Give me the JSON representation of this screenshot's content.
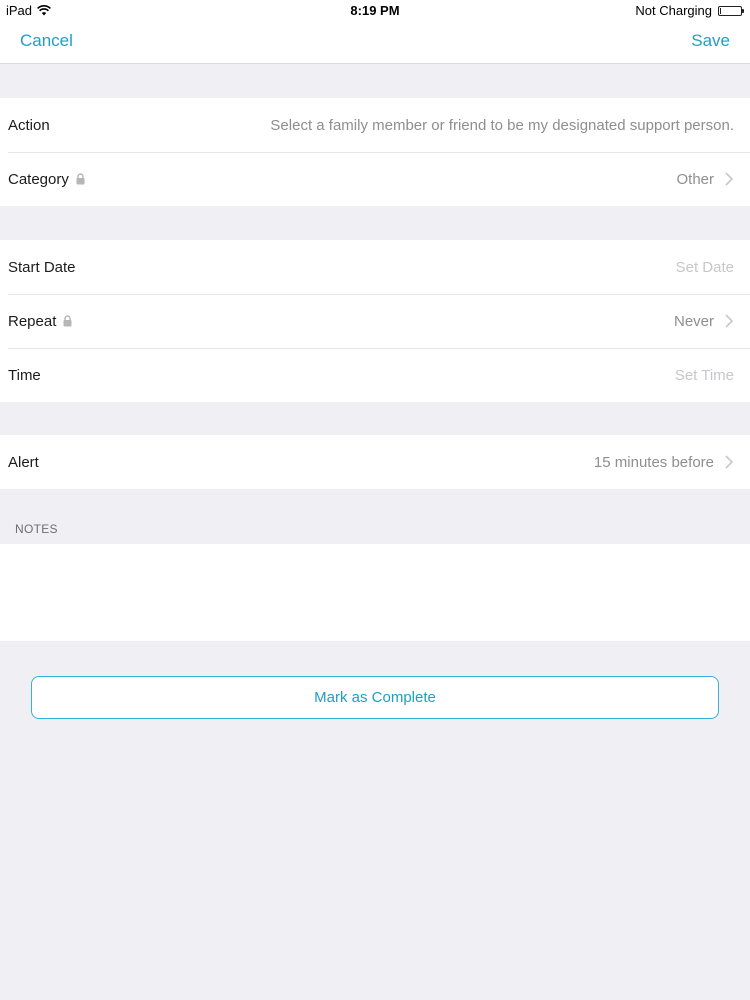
{
  "status_bar": {
    "device": "iPad",
    "time": "8:19 PM",
    "battery_status": "Not Charging"
  },
  "nav": {
    "cancel_label": "Cancel",
    "save_label": "Save"
  },
  "group1": {
    "action_label": "Action",
    "action_value": "Select a family member or friend to be my designated support person.",
    "category_label": "Category",
    "category_value": "Other"
  },
  "group2": {
    "start_date_label": "Start Date",
    "start_date_placeholder": "Set Date",
    "repeat_label": "Repeat",
    "repeat_value": "Never",
    "time_label": "Time",
    "time_placeholder": "Set Time"
  },
  "group3": {
    "alert_label": "Alert",
    "alert_value": "15 minutes before"
  },
  "notes": {
    "header": "NOTES",
    "value": ""
  },
  "complete_button_label": "Mark as Complete",
  "colors": {
    "accent": "#1ea0c4",
    "background": "#efeff4",
    "secondary_text": "#8e8e93",
    "placeholder_text": "#c7c7cc"
  },
  "icons": [
    "wifi-icon",
    "battery-icon",
    "lock-icon",
    "chevron-right-icon"
  ]
}
